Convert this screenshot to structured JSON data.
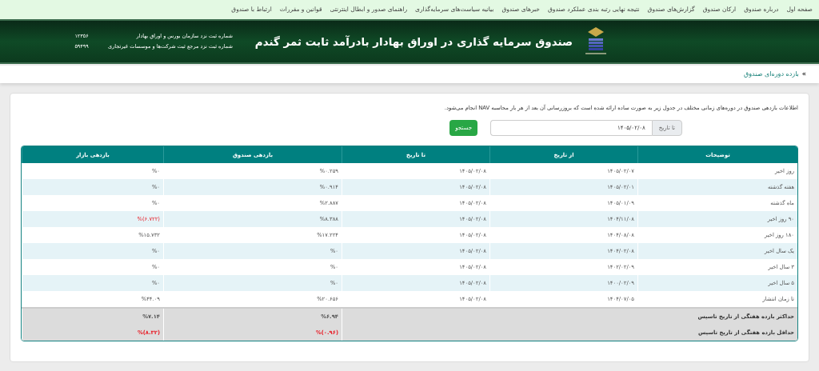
{
  "nav": [
    "صفحه اول",
    "درباره صندوق",
    "ارکان صندوق",
    "گزارش‌های صندوق",
    "نتیجه نهایی رتبه بندی عملکرد صندوق",
    "خبرهای صندوق",
    "بیانیه سیاست‌های سرمایه‌گذاری",
    "راهنمای صدور و ابطال اینترنتی",
    "قوانین و مقررات",
    "ارتباط با صندوق"
  ],
  "header": {
    "title": "صندوق سرمایه گذاری در اوراق بهادار بادرآمد ثابت ثمر گندم",
    "registrations": [
      {
        "label": "شماره ثبت نزد سازمان بورس و اوراق بهادار",
        "number": "۱۲۳۵۶"
      },
      {
        "label": "شماره ثبت نزد مرجع ثبت شرکت‌ها و موسسات غیرتجاری",
        "number": "۵۹۴۹۹"
      }
    ]
  },
  "breadcrumb": {
    "marker": "»",
    "title": "بازده دوره‌ای صندوق"
  },
  "description": "اطلاعات بازدهی صندوق در دوره‌های زمانی مختلف در جدول زیر به صورت ساده ارائه شده است که بروزرسانی آن بعد از هر بار محاسبه NAV انجام می‌شود.",
  "search": {
    "label": "تا تاریخ",
    "value": "۱۴۰۵/۰۲/۰۸",
    "button": "جستجو"
  },
  "table": {
    "columns": [
      "توضیحات",
      "از تاریخ",
      "تا تاریخ",
      "بازدهی صندوق",
      "بازدهی بازار"
    ],
    "rows": [
      {
        "description": "روز اخیر",
        "from": "۱۴۰۵/۰۲/۰۷",
        "to": "۱۴۰۵/۰۲/۰۸",
        "fund": {
          "text": "%۰.۲۵۹",
          "negative": false
        },
        "market": {
          "text": "%۰",
          "negative": false
        }
      },
      {
        "description": "هفته گذشته",
        "from": "۱۴۰۵/۰۲/۰۱",
        "to": "۱۴۰۵/۰۲/۰۸",
        "fund": {
          "text": "%۰.۹۱۴",
          "negative": false
        },
        "market": {
          "text": "%۰",
          "negative": false
        }
      },
      {
        "description": "ماه گذشته",
        "from": "۱۴۰۵/۰۱/۰۹",
        "to": "۱۴۰۵/۰۲/۰۸",
        "fund": {
          "text": "%۲.۸۸۷",
          "negative": false
        },
        "market": {
          "text": "%۰",
          "negative": false
        }
      },
      {
        "description": "۹۰ روز اخیر",
        "from": "۱۴۰۴/۱۱/۰۸",
        "to": "۱۴۰۵/۰۲/۰۸",
        "fund": {
          "text": "%۸.۳۸۸",
          "negative": false
        },
        "market": {
          "text": "%(۶.۷۲۲)",
          "negative": true
        }
      },
      {
        "description": "۱۸۰ روز اخیر",
        "from": "۱۴۰۴/۰۸/۰۸",
        "to": "۱۴۰۵/۰۲/۰۸",
        "fund": {
          "text": "%۱۷.۲۲۴",
          "negative": false
        },
        "market": {
          "text": "%۱۵.۷۳۲",
          "negative": false
        }
      },
      {
        "description": "یک سال اخیر",
        "from": "۱۴۰۴/۰۲/۰۸",
        "to": "۱۴۰۵/۰۲/۰۸",
        "fund": {
          "text": "%۰",
          "negative": false
        },
        "market": {
          "text": "%۰",
          "negative": false
        }
      },
      {
        "description": "۳ سال اخیر",
        "from": "۱۴۰۲/۰۲/۰۹",
        "to": "۱۴۰۵/۰۲/۰۸",
        "fund": {
          "text": "%۰",
          "negative": false
        },
        "market": {
          "text": "%۰",
          "negative": false
        }
      },
      {
        "description": "۵ سال اخیر",
        "from": "۱۴۰۰/۰۲/۰۹",
        "to": "۱۴۰۵/۰۲/۰۸",
        "fund": {
          "text": "%۰",
          "negative": false
        },
        "market": {
          "text": "%۰",
          "negative": false
        }
      },
      {
        "description": "تا زمان انتشار",
        "from": "۱۴۰۴/۰۷/۰۵",
        "to": "۱۴۰۵/۰۲/۰۸",
        "fund": {
          "text": "%۲۰.۶۵۶",
          "negative": false
        },
        "market": {
          "text": "%۴۴.۰۹",
          "negative": false
        }
      }
    ],
    "summary": [
      {
        "label": "حداکثر بازده هفتگی از تاریخ تاسیس",
        "fund": {
          "text": "%۶.۹۴",
          "negative": false
        },
        "market": {
          "text": "%۷.۱۴",
          "negative": false
        }
      },
      {
        "label": "حداقل بازده هفتگی از تاریخ تاسیس",
        "fund": {
          "text": "%(۰.۹۶)",
          "negative": true
        },
        "market": {
          "text": "%(۸.۳۲)",
          "negative": true
        }
      }
    ]
  }
}
